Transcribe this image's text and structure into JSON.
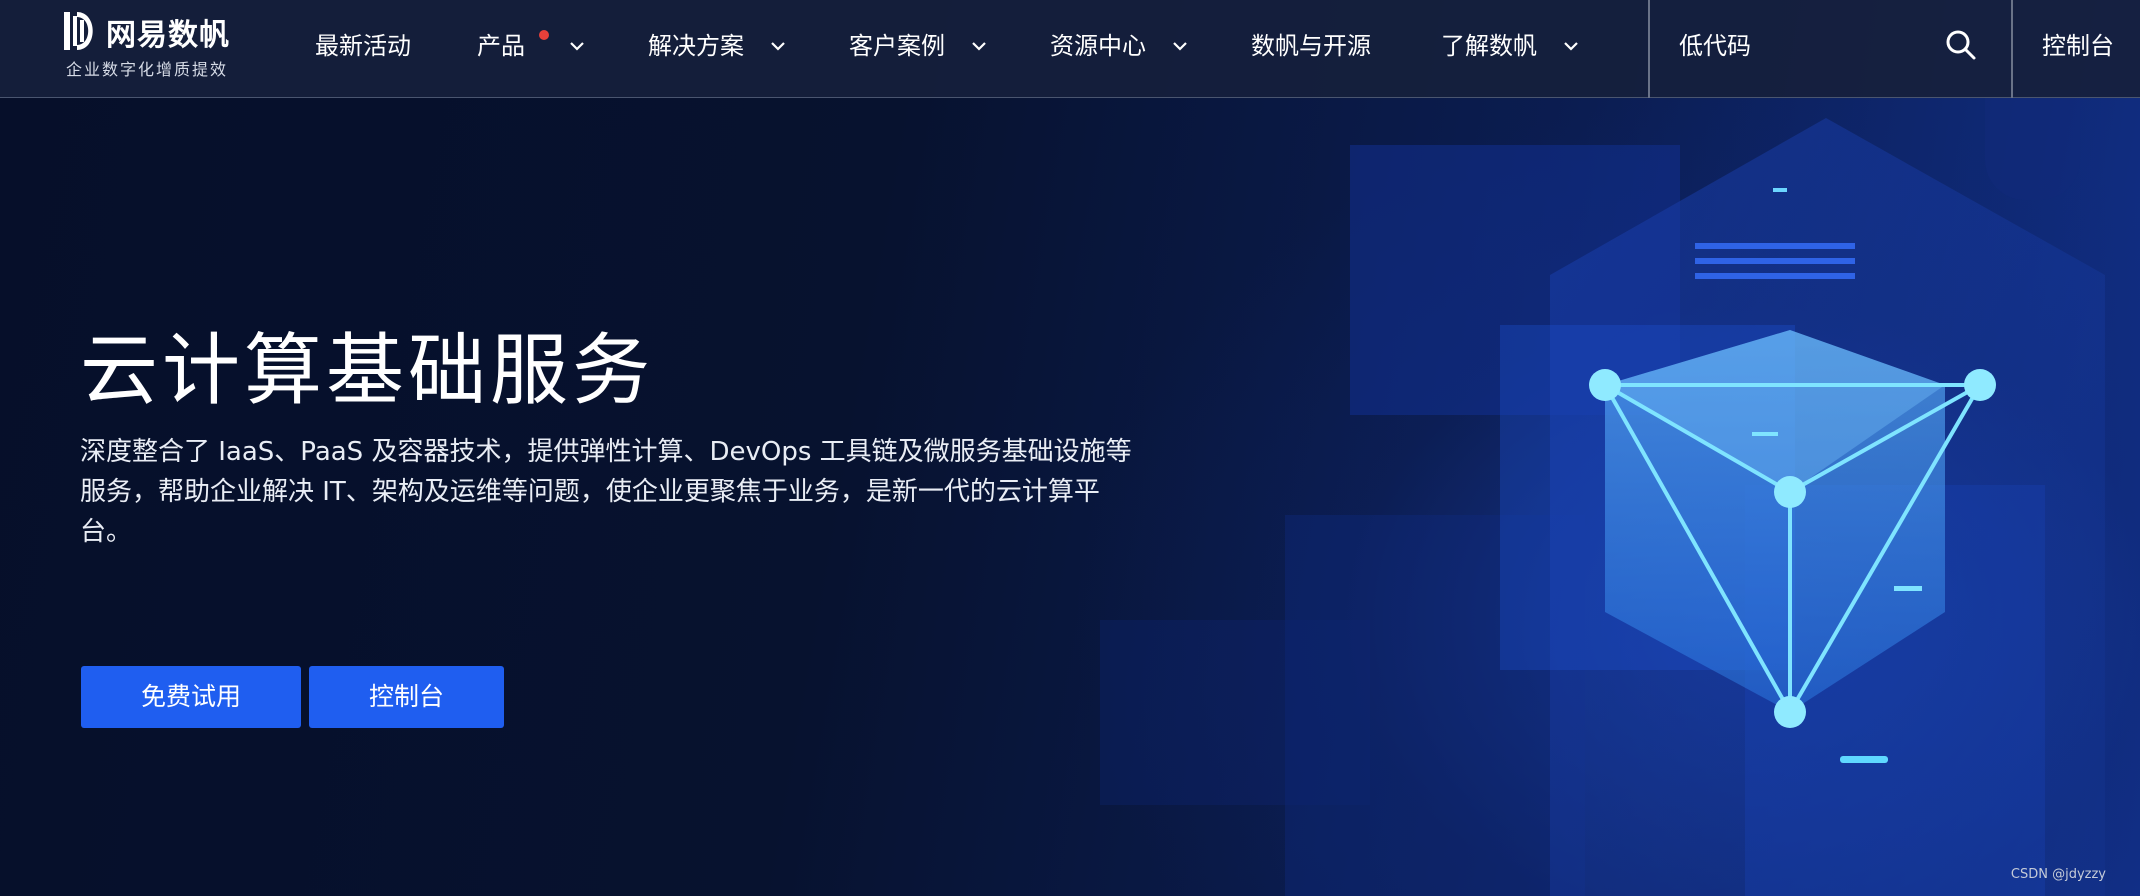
{
  "brand": {
    "name": "网易数帆",
    "slogan": "企业数字化增质提效"
  },
  "nav": {
    "items": [
      {
        "label": "最新活动",
        "has_dropdown": false,
        "has_dot": false
      },
      {
        "label": "产品",
        "has_dropdown": true,
        "has_dot": true
      },
      {
        "label": "解决方案",
        "has_dropdown": true,
        "has_dot": false
      },
      {
        "label": "客户案例",
        "has_dropdown": true,
        "has_dot": false
      },
      {
        "label": "资源中心",
        "has_dropdown": true,
        "has_dot": false
      },
      {
        "label": "数帆与开源",
        "has_dropdown": false,
        "has_dot": false
      },
      {
        "label": "了解数帆",
        "has_dropdown": true,
        "has_dot": false
      }
    ],
    "lowcode_label": "低代码",
    "console_label": "控制台",
    "search_icon": "search-icon"
  },
  "hero": {
    "title": "云计算基础服务",
    "description": "深度整合了 IaaS、PaaS 及容器技术，提供弹性计算、DevOps 工具链及微服务基础设施等服务，帮助企业解决 IT、架构及运维等问题，使企业更聚焦于业务，是新一代的云计算平台。",
    "primary_button": "免费试用",
    "secondary_button": "控制台"
  },
  "watermark": "CSDN @jdyzzy",
  "colors": {
    "accent": "#1f5ef0",
    "nav_bg": "#16203c",
    "hero_bg": "#08122e",
    "notification_dot": "#e8403a",
    "cube_edge": "#7fe4ff"
  }
}
